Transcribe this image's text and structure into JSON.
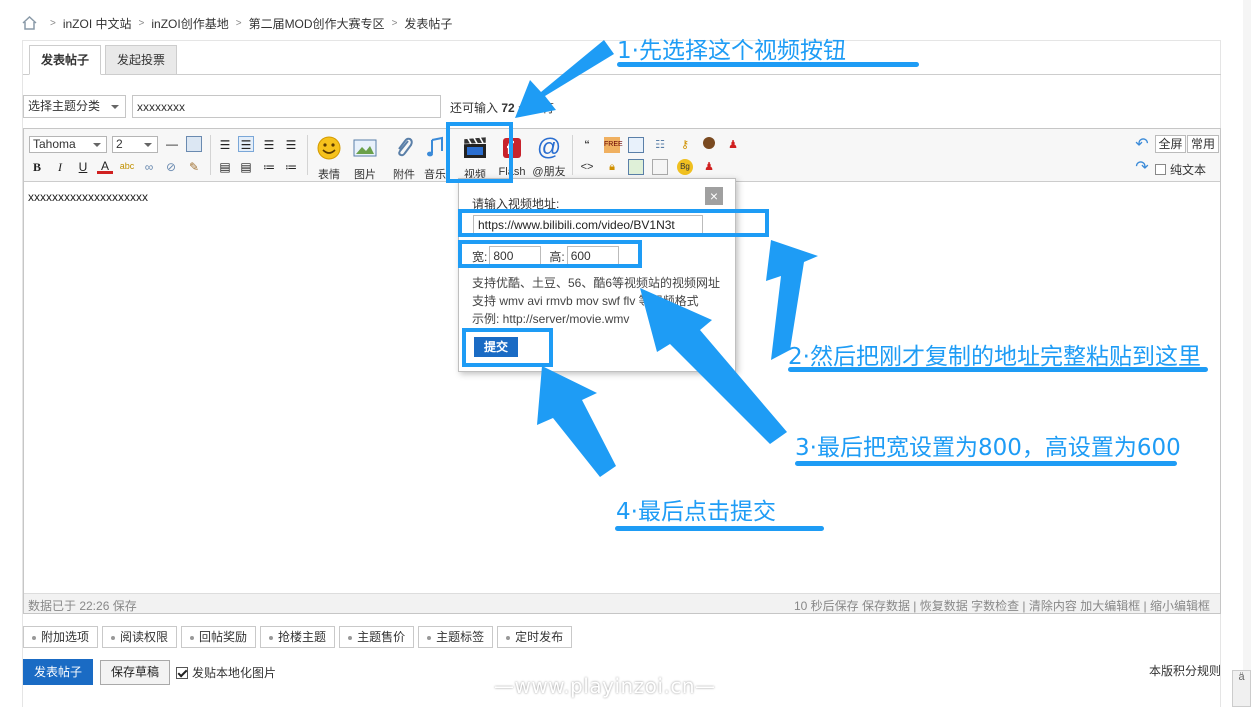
{
  "breadcrumb": [
    "inZOI 中文站",
    "inZOI创作基地",
    "第二届MOD创作大赛专区",
    "发表帖子"
  ],
  "tabs": [
    "发表帖子",
    "发起投票"
  ],
  "form": {
    "category": "选择主题分类",
    "title_value": "xxxxxxxx",
    "remain_prefix": "还可输入",
    "remain_count": "72",
    "remain_suffix": "个字符"
  },
  "toolbar": {
    "font": "Tahoma",
    "size": "2",
    "bold": "B",
    "italic": "I",
    "underline": "U",
    "color": "A",
    "emoji": "表情",
    "image": "图片",
    "attach": "附件",
    "audio": "音乐",
    "video": "视频",
    "flash": "Flash",
    "mention": "@朋友",
    "fullscreen": "全屏",
    "common": "常用",
    "plaintext": "纯文本"
  },
  "editor": {
    "content": "xxxxxxxxxxxxxxxxxxxx",
    "autosave": "数据已于 22:26 保存",
    "status_right": "10 秒后保存 保存数据 | 恢复数据    字数检查 | 清除内容    加大编辑框 | 缩小编辑框"
  },
  "popup": {
    "label": "请输入视频地址:",
    "url": "https://www.bilibili.com/video/BV1N3t",
    "width_label": "宽:",
    "width": "800",
    "height_label": "高:",
    "height": "600",
    "help1": "支持优酷、土豆、56、酷6等视频站的视频网址",
    "help2": "支持 wmv avi rmvb mov swf flv 等视频格式",
    "help3": "示例: http://server/movie.wmv",
    "submit": "提交",
    "close": "×"
  },
  "annotations": {
    "a1": "1·先选择这个视频按钮",
    "a2": "2·然后把刚才复制的地址完整粘贴到这里",
    "a3": "3·最后把宽设置为800，高设置为600",
    "a4": "4·最后点击提交"
  },
  "options": [
    "附加选项",
    "阅读权限",
    "回帖奖励",
    "抢楼主题",
    "主题售价",
    "主题标签",
    "定时发布"
  ],
  "footer": {
    "post": "发表帖子",
    "draft": "保存草稿",
    "localize": "发贴本地化图片",
    "rules": "本版积分规则",
    "watermark": "—www.playinzoi.cn—",
    "side_tab": "ä"
  },
  "colors": {
    "accent": "#1e9cf5",
    "primary": "#1a6bc4"
  }
}
